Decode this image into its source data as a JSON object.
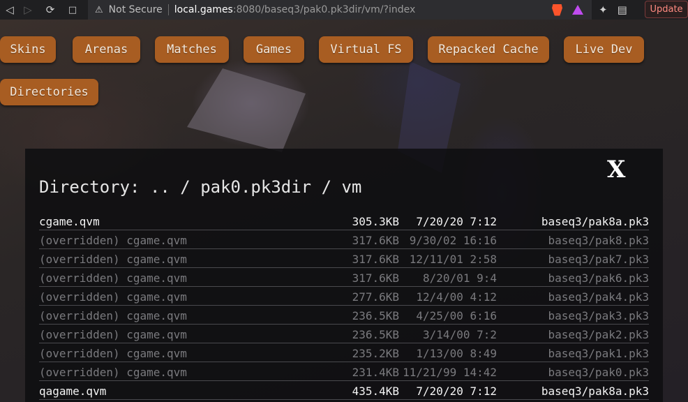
{
  "browser": {
    "url_security": "Not Secure",
    "url_host": "local.games",
    "url_rest": ":8080/baseq3/pak0.pk3dir/vm/?index",
    "update_label": "Update"
  },
  "nav": {
    "buttons": [
      "Skins",
      "Arenas",
      "Matches",
      "Games",
      "Virtual FS",
      "Repacked Cache",
      "Live Dev",
      "Directories"
    ]
  },
  "panel": {
    "close_label": "X",
    "title": "Directory: .. / pak0.pk3dir / vm",
    "files": [
      {
        "name": "cgame.qvm",
        "size": "305.3KB",
        "date": "7/20/20 7:12",
        "pak": "baseq3/pak8a.pk3",
        "overridden": false
      },
      {
        "name": "(overridden) cgame.qvm",
        "size": "317.6KB",
        "date": "9/30/02 16:16",
        "pak": "baseq3/pak8.pk3",
        "overridden": true
      },
      {
        "name": "(overridden) cgame.qvm",
        "size": "317.6KB",
        "date": "12/11/01 2:58",
        "pak": "baseq3/pak7.pk3",
        "overridden": true
      },
      {
        "name": "(overridden) cgame.qvm",
        "size": "317.6KB",
        "date": "8/20/01 9:4",
        "pak": "baseq3/pak6.pk3",
        "overridden": true
      },
      {
        "name": "(overridden) cgame.qvm",
        "size": "277.6KB",
        "date": "12/4/00 4:12",
        "pak": "baseq3/pak4.pk3",
        "overridden": true
      },
      {
        "name": "(overridden) cgame.qvm",
        "size": "236.5KB",
        "date": "4/25/00 6:16",
        "pak": "baseq3/pak3.pk3",
        "overridden": true
      },
      {
        "name": "(overridden) cgame.qvm",
        "size": "236.5KB",
        "date": "3/14/00 7:2",
        "pak": "baseq3/pak2.pk3",
        "overridden": true
      },
      {
        "name": "(overridden) cgame.qvm",
        "size": "235.2KB",
        "date": "1/13/00 8:49",
        "pak": "baseq3/pak1.pk3",
        "overridden": true
      },
      {
        "name": "(overridden) cgame.qvm",
        "size": "231.4KB",
        "date": "11/21/99 14:42",
        "pak": "baseq3/pak0.pk3",
        "overridden": true
      },
      {
        "name": "qagame.qvm",
        "size": "435.4KB",
        "date": "7/20/20 7:12",
        "pak": "baseq3/pak8a.pk3",
        "overridden": false
      }
    ]
  }
}
